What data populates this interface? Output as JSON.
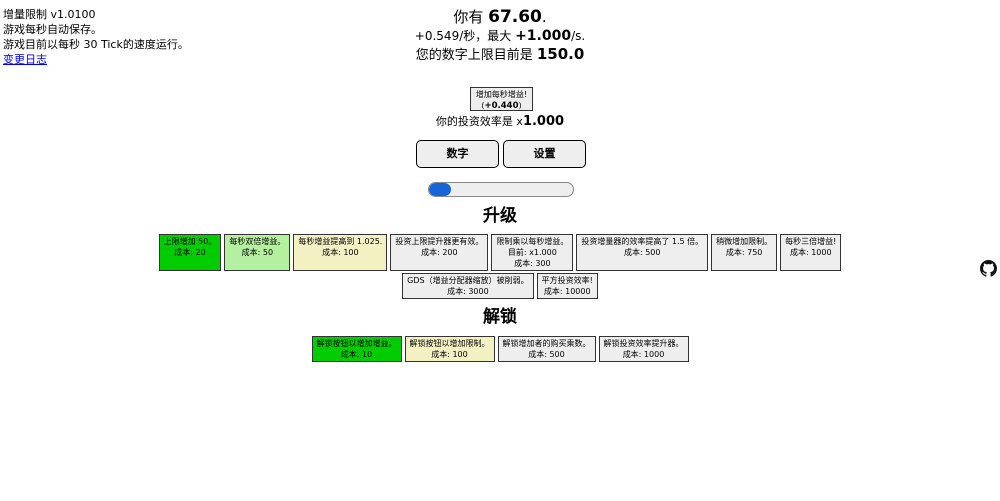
{
  "info": {
    "title": "增量限制 v1.0100",
    "autosave": "游戏每秒自动保存。",
    "tick": "游戏目前以每秒 30 Tick的速度运行。",
    "changelog": "变更日志"
  },
  "stats": {
    "have_prefix": "你有 ",
    "have_value": "67.60",
    "have_suffix": ".",
    "rate_prefix": "+0.549/秒，最大 ",
    "rate_value": "+1.000",
    "rate_suffix": "/s.",
    "cap_prefix": "您的数字上限目前是 ",
    "cap_value": "150.0"
  },
  "gain_button": {
    "label": "增加每秒增益!",
    "value_open": "(",
    "value": "+0.440",
    "value_close": ")"
  },
  "efficiency": {
    "prefix": "你的投资效率是 x",
    "value": "1.000"
  },
  "tabs": {
    "number": "数字",
    "settings": "设置"
  },
  "progress": {
    "fraction": 0.15,
    "color": "#1565d8"
  },
  "sections": {
    "upgrades": "升级",
    "unlocks": "解锁"
  },
  "upgrades_row1": [
    {
      "name": "上限增加 50。",
      "extra": "",
      "cost": "成本: 20",
      "state": "bought"
    },
    {
      "name": "每秒双倍增益。",
      "extra": "",
      "cost": "成本: 50",
      "state": "afford"
    },
    {
      "name": "每秒增益提高到 1.025.",
      "extra": "",
      "cost": "成本: 100",
      "state": "near"
    },
    {
      "name": "投资上限提升器更有效。",
      "extra": "",
      "cost": "成本: 200",
      "state": "locked"
    },
    {
      "name": "限制乘以每秒增益。",
      "extra": "目前:  x1.000",
      "cost": "成本: 300",
      "state": "locked"
    },
    {
      "name": "投资增量器的效率提高了 1.5 倍。",
      "extra": "",
      "cost": "成本: 500",
      "state": "locked"
    },
    {
      "name": "稍微增加限制。",
      "extra": "",
      "cost": "成本: 750",
      "state": "locked"
    },
    {
      "name": "每秒三倍增益!",
      "extra": "",
      "cost": "成本: 1000",
      "state": "locked"
    }
  ],
  "upgrades_row2": [
    {
      "name": "GDS（增益分配器缩放）被削弱。",
      "extra": "",
      "cost": "成本: 3000",
      "state": "locked"
    },
    {
      "name": "平方投资效率!",
      "extra": "",
      "cost": "成本: 10000",
      "state": "locked"
    }
  ],
  "unlocks": [
    {
      "name": "解锁按钮以增加增益。",
      "extra": "",
      "cost": "成本: 10",
      "state": "bought"
    },
    {
      "name": "解锁按钮以增加限制。",
      "extra": "",
      "cost": "成本: 100",
      "state": "near"
    },
    {
      "name": "解锁增加者的购买乘数。",
      "extra": "",
      "cost": "成本: 500",
      "state": "locked"
    },
    {
      "name": "解锁投资效率提升器。",
      "extra": "",
      "cost": "成本: 1000",
      "state": "locked"
    }
  ],
  "colors": {
    "bought": "#00cc00",
    "afford": "#b5f0a0",
    "near": "#f3f0c4",
    "locked": "#eeeeee"
  },
  "icons": {
    "github": "github-icon"
  }
}
